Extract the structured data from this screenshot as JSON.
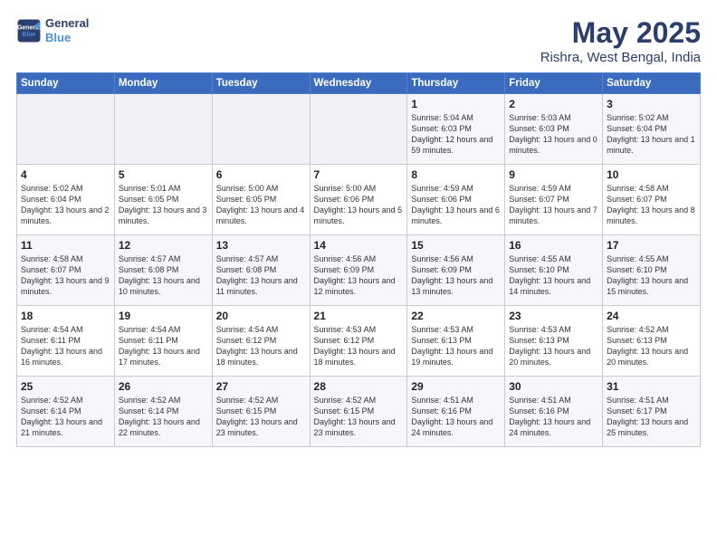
{
  "header": {
    "logo_line1": "General",
    "logo_line2": "Blue",
    "title": "May 2025",
    "subtitle": "Rishra, West Bengal, India"
  },
  "weekdays": [
    "Sunday",
    "Monday",
    "Tuesday",
    "Wednesday",
    "Thursday",
    "Friday",
    "Saturday"
  ],
  "weeks": [
    [
      {
        "day": "",
        "sunrise": "",
        "sunset": "",
        "daylight": ""
      },
      {
        "day": "",
        "sunrise": "",
        "sunset": "",
        "daylight": ""
      },
      {
        "day": "",
        "sunrise": "",
        "sunset": "",
        "daylight": ""
      },
      {
        "day": "",
        "sunrise": "",
        "sunset": "",
        "daylight": ""
      },
      {
        "day": "1",
        "sunrise": "Sunrise: 5:04 AM",
        "sunset": "Sunset: 6:03 PM",
        "daylight": "Daylight: 12 hours and 59 minutes."
      },
      {
        "day": "2",
        "sunrise": "Sunrise: 5:03 AM",
        "sunset": "Sunset: 6:03 PM",
        "daylight": "Daylight: 13 hours and 0 minutes."
      },
      {
        "day": "3",
        "sunrise": "Sunrise: 5:02 AM",
        "sunset": "Sunset: 6:04 PM",
        "daylight": "Daylight: 13 hours and 1 minute."
      }
    ],
    [
      {
        "day": "4",
        "sunrise": "Sunrise: 5:02 AM",
        "sunset": "Sunset: 6:04 PM",
        "daylight": "Daylight: 13 hours and 2 minutes."
      },
      {
        "day": "5",
        "sunrise": "Sunrise: 5:01 AM",
        "sunset": "Sunset: 6:05 PM",
        "daylight": "Daylight: 13 hours and 3 minutes."
      },
      {
        "day": "6",
        "sunrise": "Sunrise: 5:00 AM",
        "sunset": "Sunset: 6:05 PM",
        "daylight": "Daylight: 13 hours and 4 minutes."
      },
      {
        "day": "7",
        "sunrise": "Sunrise: 5:00 AM",
        "sunset": "Sunset: 6:06 PM",
        "daylight": "Daylight: 13 hours and 5 minutes."
      },
      {
        "day": "8",
        "sunrise": "Sunrise: 4:59 AM",
        "sunset": "Sunset: 6:06 PM",
        "daylight": "Daylight: 13 hours and 6 minutes."
      },
      {
        "day": "9",
        "sunrise": "Sunrise: 4:59 AM",
        "sunset": "Sunset: 6:07 PM",
        "daylight": "Daylight: 13 hours and 7 minutes."
      },
      {
        "day": "10",
        "sunrise": "Sunrise: 4:58 AM",
        "sunset": "Sunset: 6:07 PM",
        "daylight": "Daylight: 13 hours and 8 minutes."
      }
    ],
    [
      {
        "day": "11",
        "sunrise": "Sunrise: 4:58 AM",
        "sunset": "Sunset: 6:07 PM",
        "daylight": "Daylight: 13 hours and 9 minutes."
      },
      {
        "day": "12",
        "sunrise": "Sunrise: 4:57 AM",
        "sunset": "Sunset: 6:08 PM",
        "daylight": "Daylight: 13 hours and 10 minutes."
      },
      {
        "day": "13",
        "sunrise": "Sunrise: 4:57 AM",
        "sunset": "Sunset: 6:08 PM",
        "daylight": "Daylight: 13 hours and 11 minutes."
      },
      {
        "day": "14",
        "sunrise": "Sunrise: 4:56 AM",
        "sunset": "Sunset: 6:09 PM",
        "daylight": "Daylight: 13 hours and 12 minutes."
      },
      {
        "day": "15",
        "sunrise": "Sunrise: 4:56 AM",
        "sunset": "Sunset: 6:09 PM",
        "daylight": "Daylight: 13 hours and 13 minutes."
      },
      {
        "day": "16",
        "sunrise": "Sunrise: 4:55 AM",
        "sunset": "Sunset: 6:10 PM",
        "daylight": "Daylight: 13 hours and 14 minutes."
      },
      {
        "day": "17",
        "sunrise": "Sunrise: 4:55 AM",
        "sunset": "Sunset: 6:10 PM",
        "daylight": "Daylight: 13 hours and 15 minutes."
      }
    ],
    [
      {
        "day": "18",
        "sunrise": "Sunrise: 4:54 AM",
        "sunset": "Sunset: 6:11 PM",
        "daylight": "Daylight: 13 hours and 16 minutes."
      },
      {
        "day": "19",
        "sunrise": "Sunrise: 4:54 AM",
        "sunset": "Sunset: 6:11 PM",
        "daylight": "Daylight: 13 hours and 17 minutes."
      },
      {
        "day": "20",
        "sunrise": "Sunrise: 4:54 AM",
        "sunset": "Sunset: 6:12 PM",
        "daylight": "Daylight: 13 hours and 18 minutes."
      },
      {
        "day": "21",
        "sunrise": "Sunrise: 4:53 AM",
        "sunset": "Sunset: 6:12 PM",
        "daylight": "Daylight: 13 hours and 18 minutes."
      },
      {
        "day": "22",
        "sunrise": "Sunrise: 4:53 AM",
        "sunset": "Sunset: 6:13 PM",
        "daylight": "Daylight: 13 hours and 19 minutes."
      },
      {
        "day": "23",
        "sunrise": "Sunrise: 4:53 AM",
        "sunset": "Sunset: 6:13 PM",
        "daylight": "Daylight: 13 hours and 20 minutes."
      },
      {
        "day": "24",
        "sunrise": "Sunrise: 4:52 AM",
        "sunset": "Sunset: 6:13 PM",
        "daylight": "Daylight: 13 hours and 20 minutes."
      }
    ],
    [
      {
        "day": "25",
        "sunrise": "Sunrise: 4:52 AM",
        "sunset": "Sunset: 6:14 PM",
        "daylight": "Daylight: 13 hours and 21 minutes."
      },
      {
        "day": "26",
        "sunrise": "Sunrise: 4:52 AM",
        "sunset": "Sunset: 6:14 PM",
        "daylight": "Daylight: 13 hours and 22 minutes."
      },
      {
        "day": "27",
        "sunrise": "Sunrise: 4:52 AM",
        "sunset": "Sunset: 6:15 PM",
        "daylight": "Daylight: 13 hours and 23 minutes."
      },
      {
        "day": "28",
        "sunrise": "Sunrise: 4:52 AM",
        "sunset": "Sunset: 6:15 PM",
        "daylight": "Daylight: 13 hours and 23 minutes."
      },
      {
        "day": "29",
        "sunrise": "Sunrise: 4:51 AM",
        "sunset": "Sunset: 6:16 PM",
        "daylight": "Daylight: 13 hours and 24 minutes."
      },
      {
        "day": "30",
        "sunrise": "Sunrise: 4:51 AM",
        "sunset": "Sunset: 6:16 PM",
        "daylight": "Daylight: 13 hours and 24 minutes."
      },
      {
        "day": "31",
        "sunrise": "Sunrise: 4:51 AM",
        "sunset": "Sunset: 6:17 PM",
        "daylight": "Daylight: 13 hours and 25 minutes."
      }
    ]
  ]
}
